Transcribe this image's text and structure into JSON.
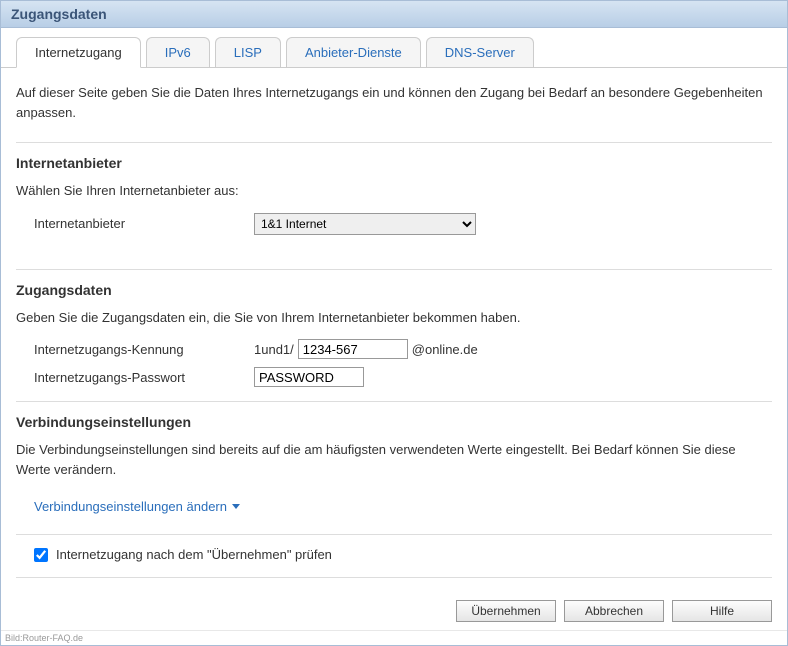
{
  "title": "Zugangsdaten",
  "tabs": [
    {
      "label": "Internetzugang",
      "active": true
    },
    {
      "label": "IPv6",
      "active": false
    },
    {
      "label": "LISP",
      "active": false
    },
    {
      "label": "Anbieter-Dienste",
      "active": false
    },
    {
      "label": "DNS-Server",
      "active": false
    }
  ],
  "intro": "Auf dieser Seite geben Sie die Daten Ihres Internetzugangs ein und können den Zugang bei Bedarf an besondere Gegebenheiten anpassen.",
  "provider_section": {
    "title": "Internetanbieter",
    "desc": "Wählen Sie Ihren Internetanbieter aus:",
    "label": "Internetanbieter",
    "selected": "1&1 Internet"
  },
  "credentials_section": {
    "title": "Zugangsdaten",
    "desc": "Geben Sie die Zugangsdaten ein, die Sie von Ihrem Internetanbieter bekommen haben.",
    "username_label": "Internetzugangs-Kennung",
    "username_prefix": "1und1/",
    "username_value": "1234-567",
    "username_suffix": "@online.de",
    "password_label": "Internetzugangs-Passwort",
    "password_value": "PASSWORD"
  },
  "connection_section": {
    "title": "Verbindungseinstellungen",
    "desc": "Die Verbindungseinstellungen sind bereits auf die am häufigsten verwendeten Werte eingestellt. Bei Bedarf können Sie diese Werte verändern.",
    "toggle_label": "Verbindungseinstellungen ändern",
    "checkbox_label": "Internetzugang nach dem \"Übernehmen\" prüfen",
    "checkbox_checked": true
  },
  "buttons": {
    "apply": "Übernehmen",
    "cancel": "Abbrechen",
    "help": "Hilfe"
  },
  "footer": "Bild:Router-FAQ.de"
}
